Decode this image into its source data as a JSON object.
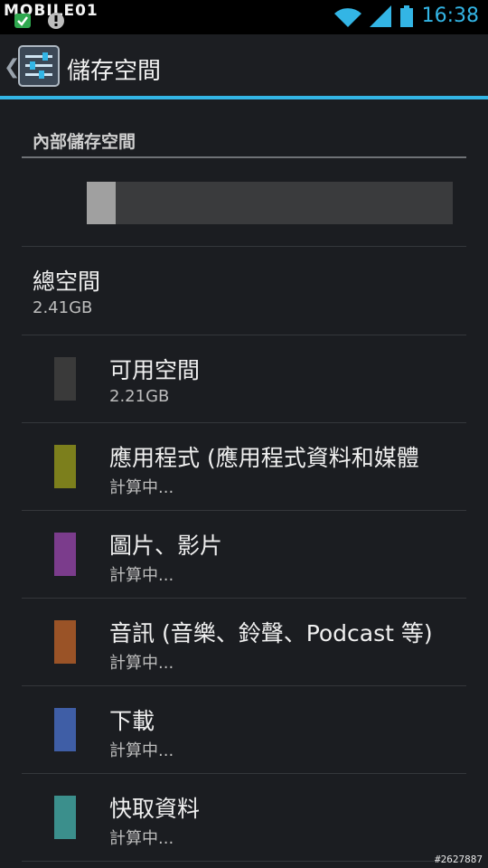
{
  "status_bar": {
    "watermark": "MOBILE01",
    "time": "16:38",
    "icons": [
      "check-icon",
      "alert-icon",
      "wifi-icon",
      "signal-icon",
      "battery-icon"
    ]
  },
  "action_bar": {
    "back_glyph": "❮",
    "title": "儲存空間",
    "icon": "settings-sliders-icon"
  },
  "storage": {
    "section_title": "內部儲存空間",
    "used_fraction": 0.08,
    "total_label": "總空間",
    "total_size": "2.41GB",
    "categories": [
      {
        "title": "可用空間",
        "value": "2.21GB",
        "color": "#3a3a3a"
      },
      {
        "title": "應用程式 (應用程式資料和媒體",
        "value": "計算中...",
        "color": "#7c7f1c"
      },
      {
        "title": "圖片、影片",
        "value": "計算中...",
        "color": "#7b3c8c"
      },
      {
        "title": "音訊 (音樂、鈴聲、Podcast 等)",
        "value": "計算中...",
        "color": "#9a5327"
      },
      {
        "title": "下載",
        "value": "計算中...",
        "color": "#3f5ea6"
      },
      {
        "title": "快取資料",
        "value": "計算中...",
        "color": "#3b8f8c"
      }
    ]
  },
  "footer": {
    "tag": "#2627887"
  },
  "colors": {
    "accent": "#33b5e5",
    "background": "#1b1d21"
  }
}
